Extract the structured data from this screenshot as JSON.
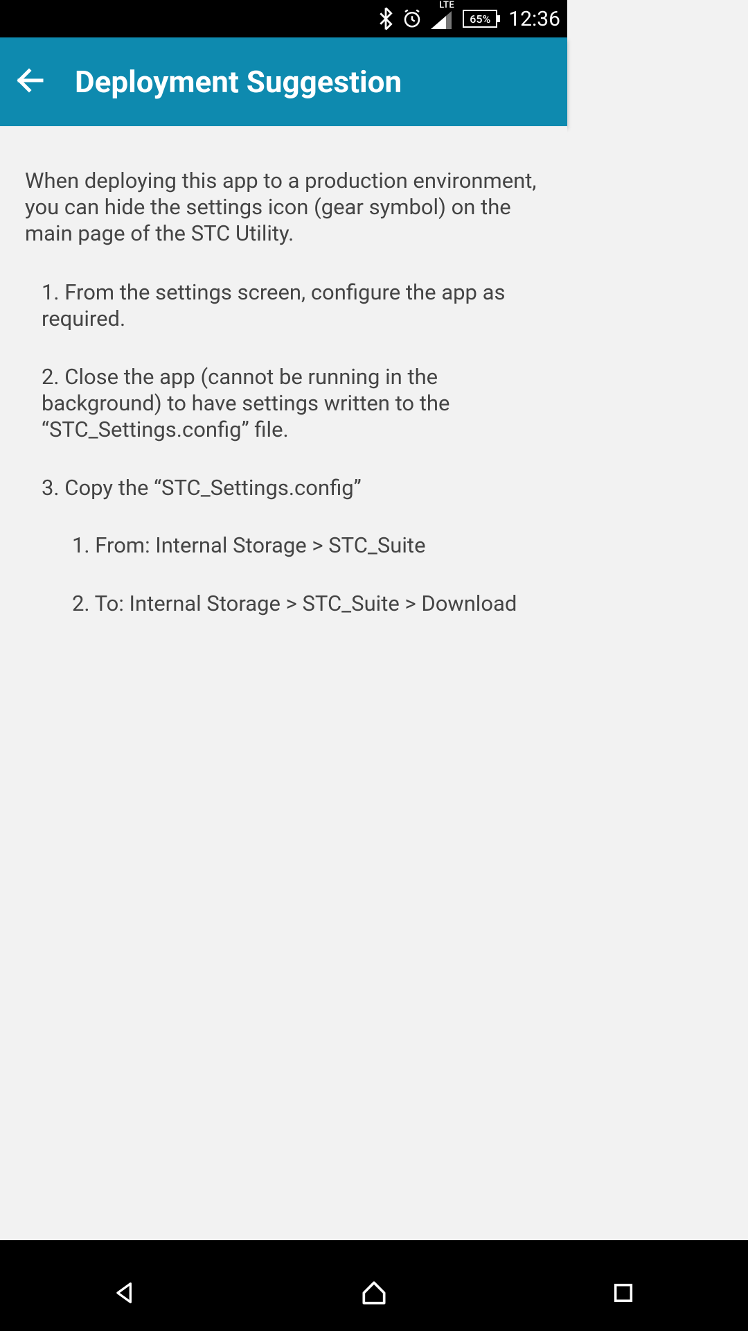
{
  "status": {
    "lte": "LTE",
    "battery_pct": "65%",
    "clock": "12:36"
  },
  "appbar": {
    "title": "Deployment Suggestion"
  },
  "content": {
    "intro": "When deploying this app to a production environment, you can hide the settings icon (gear symbol) on the main page of the STC Utility.",
    "step1": "1. From the settings screen, configure the app as required.",
    "step2": "2. Close the app (cannot be running in the background) to have settings written to the “STC_Settings.config” file.",
    "step3": "3. Copy the “STC_Settings.config”",
    "sub1": "1. From: Internal Storage > STC_Suite",
    "sub2": "2. To: Internal Storage > STC_Suite > Download"
  }
}
